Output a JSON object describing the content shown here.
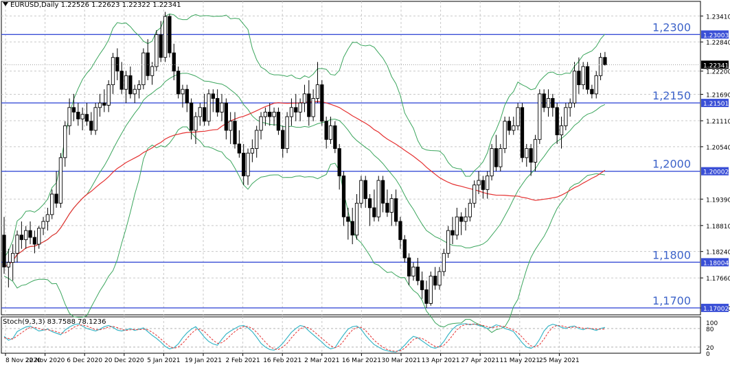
{
  "header": {
    "symbol_line": "EURUSD,Daily  1.22526 1.22623 1.22322 1.22341"
  },
  "stoch_header": "Stoch(9,3,3) 83.7588 78.1236",
  "colors": {
    "bull_body": "#ffffff",
    "bear_body": "#000000",
    "level_line": "#3a4fd6",
    "level_text": "#3d63c9",
    "ma": "#e53030",
    "bands": "#3aa55c",
    "stoch_main": "#3ab7c8",
    "stoch_signal": "#e53030",
    "grid": "#c8c8c8"
  },
  "chart_data": [
    {
      "type": "candlestick",
      "symbol": "EURUSD",
      "timeframe": "Daily",
      "ohlc_last": {
        "open": 1.22526,
        "high": 1.22623,
        "low": 1.22322,
        "close": 1.22341
      },
      "ylim": [
        1.1685,
        1.2355
      ],
      "y_ticks": [
        "1.23410",
        "1.22840",
        "1.22200",
        "1.21690",
        "1.21110",
        "1.20540",
        "1.19390",
        "1.18810",
        "1.18240",
        "1.17660",
        "1.17000"
      ],
      "x_ticks": [
        "8 Nov 2020",
        "22 Nov 2020",
        "6 Dec 2020",
        "20 Dec 2020",
        "5 Jan 2021",
        "19 Jan 2021",
        "2 Feb 2021",
        "16 Feb 2021",
        "2 Mar 2021",
        "16 Mar 2021",
        "30 Mar 2021",
        "13 Apr 2021",
        "27 Apr 2021",
        "11 May 2021",
        "25 May 2021"
      ],
      "current_price_tag": "1.22341",
      "levels": [
        {
          "price": 1.23003,
          "tag": "1.23003",
          "label": "1,2300"
        },
        {
          "price": 1.21501,
          "tag": "1.21501",
          "label": "1,2150"
        },
        {
          "price": 1.20002,
          "tag": "1.20002",
          "label": "1,2000"
        },
        {
          "price": 1.18004,
          "tag": "1.18004",
          "label": "1,1800"
        },
        {
          "price": 1.17002,
          "tag": "1.17002",
          "label": "1,1700"
        }
      ],
      "candles": [
        [
          1.186,
          1.19,
          1.1775,
          1.179
        ],
        [
          1.179,
          1.183,
          1.1745,
          1.18
        ],
        [
          1.18,
          1.184,
          1.176,
          1.182
        ],
        [
          1.182,
          1.187,
          1.18,
          1.186
        ],
        [
          1.186,
          1.189,
          1.183,
          1.185
        ],
        [
          1.185,
          1.188,
          1.183,
          1.187
        ],
        [
          1.187,
          1.189,
          1.184,
          1.1855
        ],
        [
          1.1855,
          1.187,
          1.182,
          1.184
        ],
        [
          1.184,
          1.188,
          1.183,
          1.1875
        ],
        [
          1.1875,
          1.19,
          1.186,
          1.189
        ],
        [
          1.189,
          1.192,
          1.187,
          1.1905
        ],
        [
          1.1905,
          1.196,
          1.1895,
          1.195
        ],
        [
          1.195,
          1.2,
          1.192,
          1.193
        ],
        [
          1.193,
          1.204,
          1.192,
          1.203
        ],
        [
          1.203,
          1.211,
          1.201,
          1.21
        ],
        [
          1.21,
          1.216,
          1.208,
          1.214
        ],
        [
          1.214,
          1.217,
          1.211,
          1.213
        ],
        [
          1.213,
          1.215,
          1.21,
          1.2115
        ],
        [
          1.2115,
          1.214,
          1.209,
          1.2125
        ],
        [
          1.2125,
          1.215,
          1.21,
          1.211
        ],
        [
          1.211,
          1.213,
          1.208,
          1.209
        ],
        [
          1.209,
          1.215,
          1.208,
          1.214
        ],
        [
          1.214,
          1.217,
          1.212,
          1.215
        ],
        [
          1.215,
          1.218,
          1.213,
          1.2145
        ],
        [
          1.2145,
          1.22,
          1.213,
          1.219
        ],
        [
          1.219,
          1.226,
          1.217,
          1.225
        ],
        [
          1.225,
          1.227,
          1.22,
          1.222
        ],
        [
          1.222,
          1.224,
          1.217,
          1.218
        ],
        [
          1.218,
          1.222,
          1.215,
          1.221
        ],
        [
          1.221,
          1.223,
          1.216,
          1.217
        ],
        [
          1.217,
          1.219,
          1.215,
          1.218
        ],
        [
          1.218,
          1.22,
          1.216,
          1.219
        ],
        [
          1.219,
          1.227,
          1.218,
          1.226
        ],
        [
          1.226,
          1.229,
          1.22,
          1.221
        ],
        [
          1.221,
          1.224,
          1.219,
          1.223
        ],
        [
          1.223,
          1.231,
          1.222,
          1.23
        ],
        [
          1.23,
          1.233,
          1.224,
          1.225
        ],
        [
          1.225,
          1.235,
          1.224,
          1.234
        ],
        [
          1.234,
          1.2345,
          1.225,
          1.226
        ],
        [
          1.226,
          1.228,
          1.22,
          1.222
        ],
        [
          1.222,
          1.223,
          1.216,
          1.217
        ],
        [
          1.217,
          1.219,
          1.214,
          1.218
        ],
        [
          1.218,
          1.219,
          1.213,
          1.215
        ],
        [
          1.215,
          1.216,
          1.207,
          1.209
        ],
        [
          1.209,
          1.213,
          1.206,
          1.212
        ],
        [
          1.212,
          1.215,
          1.21,
          1.214
        ],
        [
          1.214,
          1.217,
          1.21,
          1.211
        ],
        [
          1.211,
          1.218,
          1.21,
          1.217
        ],
        [
          1.217,
          1.218,
          1.213,
          1.216
        ],
        [
          1.216,
          1.218,
          1.212,
          1.213
        ],
        [
          1.213,
          1.217,
          1.211,
          1.215
        ],
        [
          1.215,
          1.216,
          1.207,
          1.209
        ],
        [
          1.209,
          1.213,
          1.206,
          1.211
        ],
        [
          1.211,
          1.213,
          1.205,
          1.206
        ],
        [
          1.206,
          1.209,
          1.203,
          1.204
        ],
        [
          1.204,
          1.206,
          1.197,
          1.199
        ],
        [
          1.199,
          1.205,
          1.197,
          1.204
        ],
        [
          1.204,
          1.207,
          1.202,
          1.205
        ],
        [
          1.205,
          1.21,
          1.203,
          1.209
        ],
        [
          1.209,
          1.213,
          1.207,
          1.212
        ],
        [
          1.212,
          1.214,
          1.21,
          1.213
        ],
        [
          1.213,
          1.215,
          1.21,
          1.212
        ],
        [
          1.212,
          1.214,
          1.21,
          1.213
        ],
        [
          1.213,
          1.214,
          1.208,
          1.209
        ],
        [
          1.209,
          1.21,
          1.203,
          1.205
        ],
        [
          1.205,
          1.213,
          1.204,
          1.212
        ],
        [
          1.212,
          1.216,
          1.21,
          1.214
        ],
        [
          1.214,
          1.217,
          1.211,
          1.213
        ],
        [
          1.213,
          1.216,
          1.211,
          1.215
        ],
        [
          1.215,
          1.219,
          1.213,
          1.217
        ],
        [
          1.217,
          1.22,
          1.21,
          1.212
        ],
        [
          1.212,
          1.218,
          1.211,
          1.216
        ],
        [
          1.216,
          1.224,
          1.215,
          1.219
        ],
        [
          1.219,
          1.22,
          1.21,
          1.211
        ],
        [
          1.211,
          1.212,
          1.205,
          1.207
        ],
        [
          1.207,
          1.212,
          1.206,
          1.21
        ],
        [
          1.21,
          1.211,
          1.204,
          1.205
        ],
        [
          1.205,
          1.206,
          1.196,
          1.199
        ],
        [
          1.199,
          1.2,
          1.188,
          1.19
        ],
        [
          1.19,
          1.192,
          1.185,
          1.189
        ],
        [
          1.189,
          1.192,
          1.184,
          1.186
        ],
        [
          1.186,
          1.195,
          1.185,
          1.193
        ],
        [
          1.193,
          1.199,
          1.192,
          1.198
        ],
        [
          1.198,
          1.199,
          1.192,
          1.194
        ],
        [
          1.194,
          1.195,
          1.188,
          1.192
        ],
        [
          1.192,
          1.196,
          1.189,
          1.19
        ],
        [
          1.19,
          1.199,
          1.189,
          1.198
        ],
        [
          1.198,
          1.199,
          1.191,
          1.193
        ],
        [
          1.193,
          1.196,
          1.19,
          1.191
        ],
        [
          1.191,
          1.195,
          1.188,
          1.194
        ],
        [
          1.194,
          1.196,
          1.188,
          1.189
        ],
        [
          1.189,
          1.19,
          1.183,
          1.185
        ],
        [
          1.185,
          1.186,
          1.18,
          1.181
        ],
        [
          1.181,
          1.182,
          1.175,
          1.177
        ],
        [
          1.177,
          1.18,
          1.176,
          1.179
        ],
        [
          1.179,
          1.181,
          1.175,
          1.176
        ],
        [
          1.176,
          1.178,
          1.172,
          1.174
        ],
        [
          1.174,
          1.176,
          1.17,
          1.171
        ],
        [
          1.171,
          1.178,
          1.1705,
          1.177
        ],
        [
          1.177,
          1.179,
          1.174,
          1.175
        ],
        [
          1.175,
          1.179,
          1.174,
          1.178
        ],
        [
          1.178,
          1.183,
          1.177,
          1.182
        ],
        [
          1.182,
          1.188,
          1.181,
          1.187
        ],
        [
          1.187,
          1.19,
          1.184,
          1.186
        ],
        [
          1.186,
          1.192,
          1.185,
          1.19
        ],
        [
          1.19,
          1.191,
          1.186,
          1.189
        ],
        [
          1.189,
          1.192,
          1.187,
          1.19
        ],
        [
          1.19,
          1.194,
          1.189,
          1.193
        ],
        [
          1.193,
          1.198,
          1.192,
          1.197
        ],
        [
          1.197,
          1.2,
          1.195,
          1.198
        ],
        [
          1.198,
          1.199,
          1.194,
          1.196
        ],
        [
          1.196,
          1.2,
          1.194,
          1.199
        ],
        [
          1.199,
          1.206,
          1.198,
          1.205
        ],
        [
          1.205,
          1.208,
          1.2,
          1.201
        ],
        [
          1.201,
          1.206,
          1.2,
          1.205
        ],
        [
          1.205,
          1.212,
          1.204,
          1.211
        ],
        [
          1.211,
          1.212,
          1.208,
          1.209
        ],
        [
          1.209,
          1.212,
          1.208,
          1.21
        ],
        [
          1.21,
          1.215,
          1.209,
          1.214
        ],
        [
          1.214,
          1.215,
          1.202,
          1.203
        ],
        [
          1.203,
          1.206,
          1.201,
          1.205
        ],
        [
          1.205,
          1.206,
          1.199,
          1.202
        ],
        [
          1.202,
          1.208,
          1.2,
          1.207
        ],
        [
          1.207,
          1.218,
          1.206,
          1.217
        ],
        [
          1.217,
          1.218,
          1.213,
          1.214
        ],
        [
          1.214,
          1.218,
          1.212,
          1.216
        ],
        [
          1.216,
          1.217,
          1.212,
          1.214
        ],
        [
          1.214,
          1.215,
          1.206,
          1.208
        ],
        [
          1.208,
          1.212,
          1.205,
          1.21
        ],
        [
          1.21,
          1.215,
          1.209,
          1.214
        ],
        [
          1.214,
          1.216,
          1.212,
          1.215
        ],
        [
          1.215,
          1.224,
          1.214,
          1.222
        ],
        [
          1.222,
          1.225,
          1.217,
          1.219
        ],
        [
          1.219,
          1.224,
          1.218,
          1.223
        ],
        [
          1.223,
          1.224,
          1.217,
          1.218
        ],
        [
          1.218,
          1.219,
          1.216,
          1.217
        ],
        [
          1.217,
          1.222,
          1.216,
          1.221
        ],
        [
          1.221,
          1.226,
          1.22,
          1.225
        ],
        [
          1.225,
          1.2262,
          1.2232,
          1.2234
        ]
      ]
    },
    {
      "type": "line",
      "indicator": "Stochastic",
      "params": [
        9,
        3,
        3
      ],
      "main_last": 83.7588,
      "signal_last": 78.1236,
      "ylim": [
        0,
        100
      ],
      "y_ticks": [
        "100",
        "80",
        "20",
        "0"
      ],
      "main": [
        55,
        42,
        48,
        70,
        78,
        85,
        88,
        80,
        72,
        75,
        78,
        70,
        65,
        60,
        75,
        85,
        92,
        95,
        88,
        80,
        76,
        72,
        78,
        86,
        90,
        84,
        75,
        72,
        76,
        80,
        74,
        78,
        82,
        70,
        58,
        48,
        36,
        22,
        14,
        18,
        30,
        50,
        66,
        78,
        86,
        70,
        52,
        38,
        30,
        26,
        45,
        62,
        72,
        80,
        88,
        90,
        82,
        70,
        52,
        32,
        20,
        12,
        10,
        18,
        32,
        50,
        68,
        80,
        90,
        86,
        72,
        60,
        48,
        36,
        22,
        14,
        18,
        40,
        60,
        78,
        86,
        88,
        78,
        58,
        42,
        28,
        20,
        12,
        8,
        5,
        4,
        12,
        26,
        42,
        55,
        50,
        40,
        30,
        20,
        16,
        22,
        38,
        60,
        78,
        90,
        94,
        96,
        92,
        95,
        90,
        86,
        80,
        84,
        92,
        88,
        80,
        76,
        70,
        52,
        34,
        20,
        16,
        24,
        45,
        72,
        88,
        94,
        90,
        84,
        80,
        86,
        88,
        80,
        76,
        82,
        78,
        74,
        80,
        83.76
      ],
      "signal": [
        50,
        48,
        46,
        56,
        66,
        76,
        84,
        84,
        80,
        76,
        76,
        74,
        70,
        65,
        66,
        74,
        84,
        90,
        92,
        88,
        82,
        76,
        76,
        80,
        85,
        87,
        83,
        77,
        74,
        76,
        77,
        76,
        78,
        76,
        68,
        58,
        46,
        34,
        22,
        16,
        20,
        32,
        48,
        64,
        76,
        78,
        70,
        56,
        42,
        32,
        34,
        44,
        58,
        70,
        80,
        86,
        87,
        80,
        68,
        52,
        36,
        22,
        14,
        12,
        20,
        32,
        50,
        66,
        79,
        86,
        82,
        72,
        60,
        48,
        36,
        24,
        18,
        24,
        40,
        60,
        75,
        84,
        84,
        74,
        58,
        42,
        30,
        20,
        12,
        8,
        6,
        8,
        16,
        30,
        44,
        50,
        48,
        40,
        30,
        22,
        20,
        26,
        40,
        58,
        76,
        88,
        93,
        94,
        94,
        93,
        90,
        86,
        83,
        85,
        88,
        86,
        81,
        75,
        66,
        52,
        36,
        24,
        20,
        28,
        46,
        68,
        84,
        90,
        89,
        85,
        83,
        85,
        84,
        81,
        80,
        80,
        78,
        78,
        78.12
      ]
    }
  ]
}
